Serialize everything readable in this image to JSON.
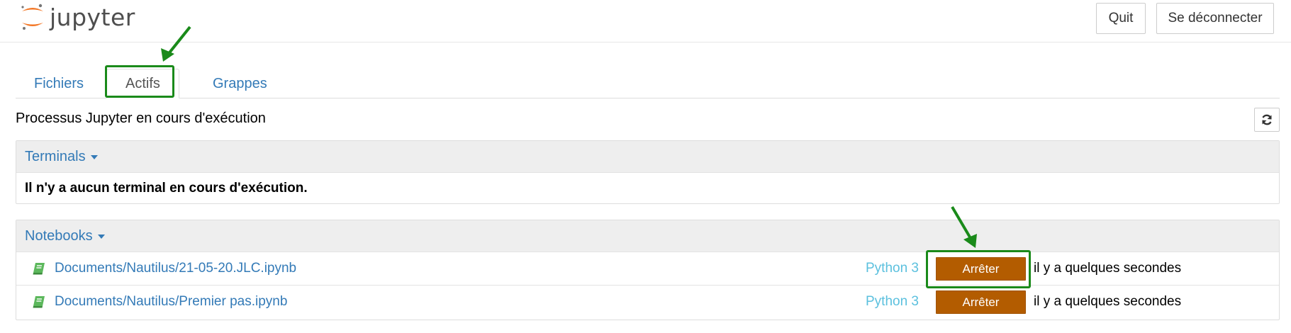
{
  "header": {
    "logo_text": "jupyter",
    "quit_label": "Quit",
    "logout_label": "Se déconnecter"
  },
  "tabs": [
    {
      "label": "Fichiers",
      "active": false
    },
    {
      "label": "Actifs",
      "active": true
    },
    {
      "label": "Grappes",
      "active": false
    }
  ],
  "running": {
    "title": "Processus Jupyter en cours d'exécution",
    "refresh_icon": "refresh-icon"
  },
  "terminals": {
    "heading": "Terminals",
    "empty_message": "Il n'y a aucun terminal en cours d'exécution."
  },
  "notebooks": {
    "heading": "Notebooks",
    "items": [
      {
        "name": "Documents/Nautilus/21-05-20.JLC.ipynb",
        "kernel": "Python 3",
        "stop_label": "Arrêter",
        "time": "il y a quelques secondes"
      },
      {
        "name": "Documents/Nautilus/Premier pas.ipynb",
        "kernel": "Python 3",
        "stop_label": "Arrêter",
        "time": "il y a quelques secondes"
      }
    ]
  },
  "colors": {
    "link": "#337ab7",
    "kernel": "#5bc0de",
    "stop_button": "#b35c00",
    "annotation": "#1a8a1a",
    "notebook_icon": "#5cb85c"
  }
}
